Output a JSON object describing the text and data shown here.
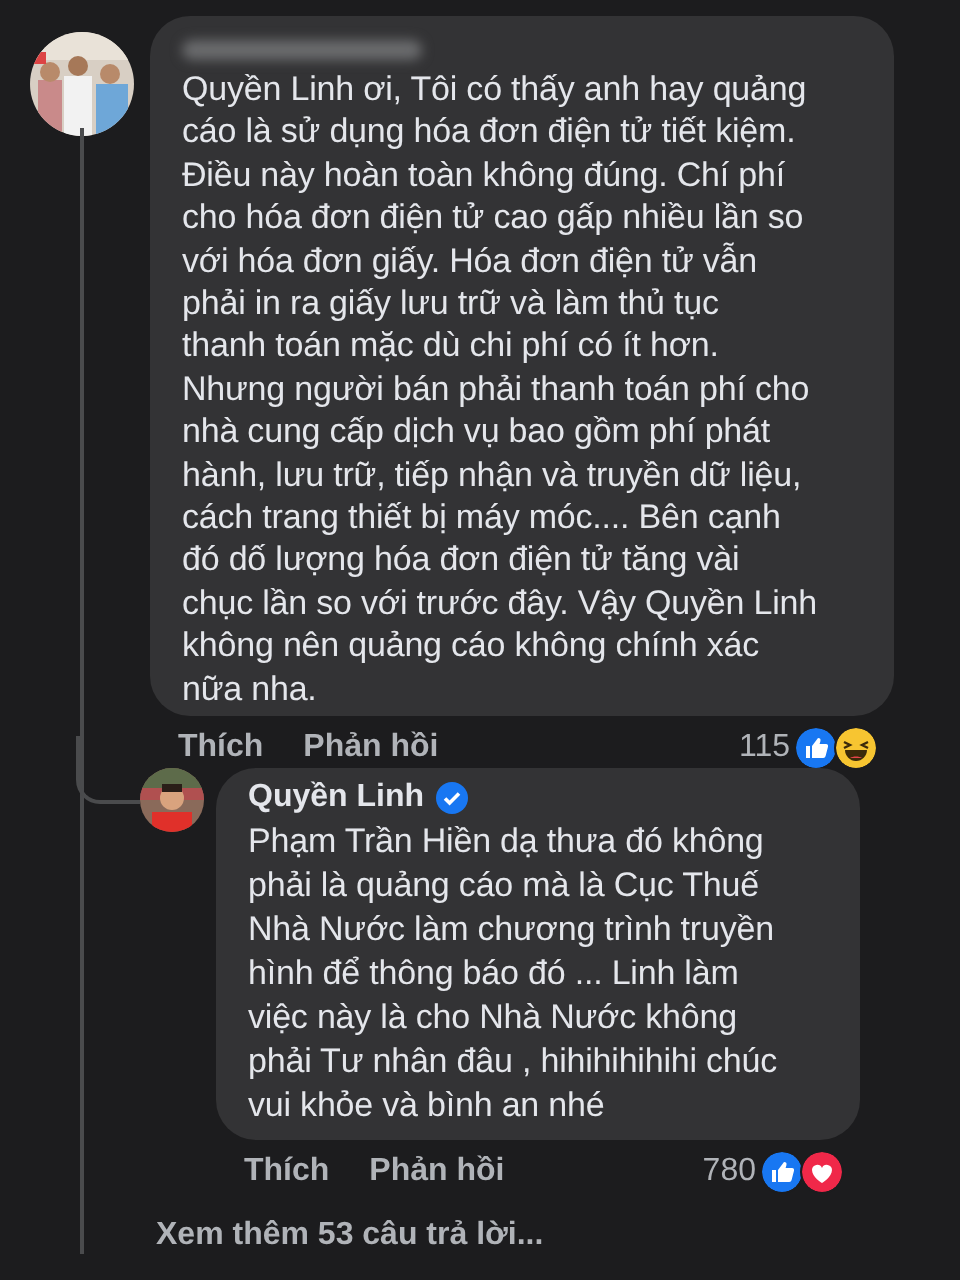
{
  "comment": {
    "lines": [
      "Quyền Linh ơi, Tôi có thấy anh hay quảng",
      "cáo là sử dụng hóa đơn điện tử tiết kiệm.",
      "Điều này hoàn toàn không đúng. Chí phí",
      "cho hóa đơn điện tử cao gấp nhiều lần so",
      "với hóa đơn giấy. Hóa đơn điện tử vẫn",
      "phải in ra giấy lưu trữ và làm thủ tục",
      "thanh toán mặc dù chi phí có ít hơn.",
      "Nhưng người bán phải thanh toán phí cho",
      "nhà cung cấp dịch vụ bao gồm phí phát",
      "hành, lưu trữ, tiếp nhận và truyền dữ liệu,",
      "cách trang thiết bị máy móc.... Bên cạnh",
      "đó dố lượng hóa đơn điện tử tăng vài",
      "chục lần so với trước đây. Vậy Quyền Linh",
      "không nên quảng cáo không chính xác",
      "nữa nha."
    ],
    "actions": [
      "Thích",
      "Phản hồi"
    ],
    "reaction_count": "115",
    "reactions": [
      {
        "kind": "like"
      },
      {
        "kind": "haha"
      }
    ]
  },
  "reply": {
    "author": "Quyền Linh",
    "verified": true,
    "lines": [
      "Phạm Trần Hiền dạ thưa  đó không",
      "phải là quảng cáo mà là Cục Thuế",
      "Nhà Nước làm chương trình truyền",
      "hình để thông báo đó ... Linh làm",
      "việc này là cho Nhà Nước không",
      "phải Tư nhân đâu , hihihihihihi chúc",
      "vui khỏe và bình an nhé"
    ],
    "actions": [
      "Thích",
      "Phản hồi"
    ],
    "reaction_count": "780",
    "reactions": [
      {
        "kind": "like"
      },
      {
        "kind": "love"
      }
    ]
  },
  "more_replies": "Xem thêm 53 câu trả lời..."
}
